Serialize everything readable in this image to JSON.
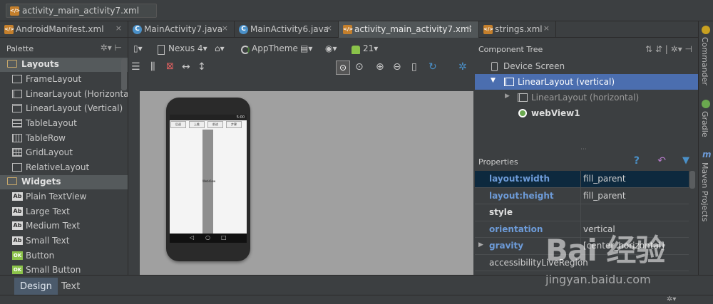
{
  "breadcrumb": {
    "file": "activity_main_activity7.xml"
  },
  "editor_tabs": [
    {
      "label": "AndroidManifest.xml",
      "type": "xml"
    },
    {
      "label": "MainActivity7.java",
      "type": "java"
    },
    {
      "label": "MainActivity6.java",
      "type": "java"
    },
    {
      "label": "activity_main_activity7.xml",
      "type": "xml",
      "active": true
    },
    {
      "label": "strings.xml",
      "type": "xml"
    }
  ],
  "close_glyph": "×",
  "palette": {
    "title": "Palette",
    "groups": [
      {
        "label": "Layouts",
        "items": [
          "FrameLayout",
          "LinearLayout (Horizontal)",
          "LinearLayout (Vertical)",
          "TableLayout",
          "TableRow",
          "GridLayout",
          "RelativeLayout"
        ]
      },
      {
        "label": "Widgets",
        "items": [
          "Plain TextView",
          "Large Text",
          "Medium Text",
          "Small Text",
          "Button",
          "Small Button"
        ]
      }
    ],
    "textview_badge": "Ab",
    "button_badge": "OK"
  },
  "toolbar": {
    "device": "Nexus 4",
    "theme": "AppTheme",
    "api": "21"
  },
  "phone": {
    "status_time": "5:00",
    "buttons": [
      "后退",
      "上推",
      "前进",
      "步骤"
    ],
    "web_label": "WebView"
  },
  "component_tree": {
    "title": "Component Tree",
    "rows": [
      {
        "label": "Device Screen"
      },
      {
        "label": "LinearLayout (vertical)",
        "selected": true
      },
      {
        "label": "LinearLayout (horizontal)"
      },
      {
        "label": "webView1"
      }
    ]
  },
  "properties": {
    "title": "Properties",
    "rows": [
      {
        "key": "layout:width",
        "value": "fill_parent",
        "style": "b",
        "selected": true
      },
      {
        "key": "layout:height",
        "value": "fill_parent",
        "style": "b"
      },
      {
        "key": "style",
        "value": "",
        "style": "w"
      },
      {
        "key": "orientation",
        "value": "vertical",
        "style": "b"
      },
      {
        "key": "gravity",
        "value": "[center_horizontal]",
        "style": "b",
        "expandable": true
      },
      {
        "key": "accessibilityLiveRegion",
        "value": "",
        "style": ""
      }
    ]
  },
  "bottom_tabs": [
    {
      "label": "Design",
      "active": true
    },
    {
      "label": "Text"
    }
  ],
  "side_tools": [
    "Commander",
    "Gradle",
    "Maven Projects"
  ],
  "watermark": {
    "logo": "Bai 经验",
    "url": "jingyan.baidu.com"
  }
}
